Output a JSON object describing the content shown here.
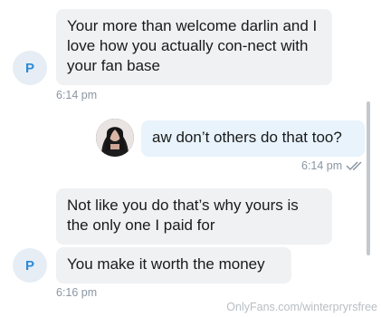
{
  "messages": [
    {
      "sender_avatar": "P",
      "text": "Your more than welcome darlin and I love how you actually con-nect with your fan base",
      "time": "6:14 pm"
    },
    {
      "text": "aw don’t others do that too?",
      "time": "6:14 pm"
    },
    {
      "text": "Not like you do that’s why yours is the only one I paid for"
    },
    {
      "sender_avatar": "P",
      "text": "You make it worth the money",
      "time": "6:16 pm"
    }
  ],
  "watermark": "OnlyFans.com/winterpryrsfree",
  "icons": {
    "read_receipt": "double-check-icon",
    "user_avatar": "user-photo-avatar",
    "sender_avatar": "letter-avatar"
  },
  "colors": {
    "incoming_bubble": "#f0f1f3",
    "outgoing_bubble": "#e8f3fc",
    "avatar_text": "#2a8ad8",
    "timestamp": "#8a96a3"
  }
}
